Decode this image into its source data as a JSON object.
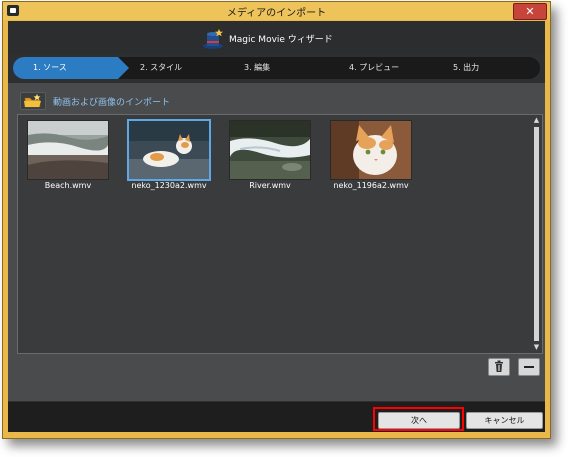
{
  "window": {
    "title": "メディアのインポート",
    "close_glyph": "✕"
  },
  "header": {
    "app_name": "Magic Movie ウィザード"
  },
  "steps": [
    {
      "label": "1. ソース",
      "active": true
    },
    {
      "label": "2. スタイル",
      "active": false
    },
    {
      "label": "3. 編集",
      "active": false
    },
    {
      "label": "4. プレビュー",
      "active": false
    },
    {
      "label": "5. 出力",
      "active": false
    }
  ],
  "import": {
    "link_text": "動画および画像のインポート",
    "icon": "folder-add-icon"
  },
  "files": [
    {
      "name": "Beach.wmv",
      "selected": false
    },
    {
      "name": "neko_1230a2.wmv",
      "selected": true
    },
    {
      "name": "River.wmv",
      "selected": false
    },
    {
      "name": "neko_1196a2.wmv",
      "selected": false
    }
  ],
  "list_actions": {
    "delete_icon": "trash-icon",
    "remove_icon": "minus-icon"
  },
  "footer": {
    "next_label": "次へ",
    "cancel_label": "キャンセル"
  },
  "colors": {
    "accent": "#2c7cc4",
    "selection": "#5fa8e6",
    "link": "#8fc1ef",
    "highlight": "#ff0000"
  }
}
